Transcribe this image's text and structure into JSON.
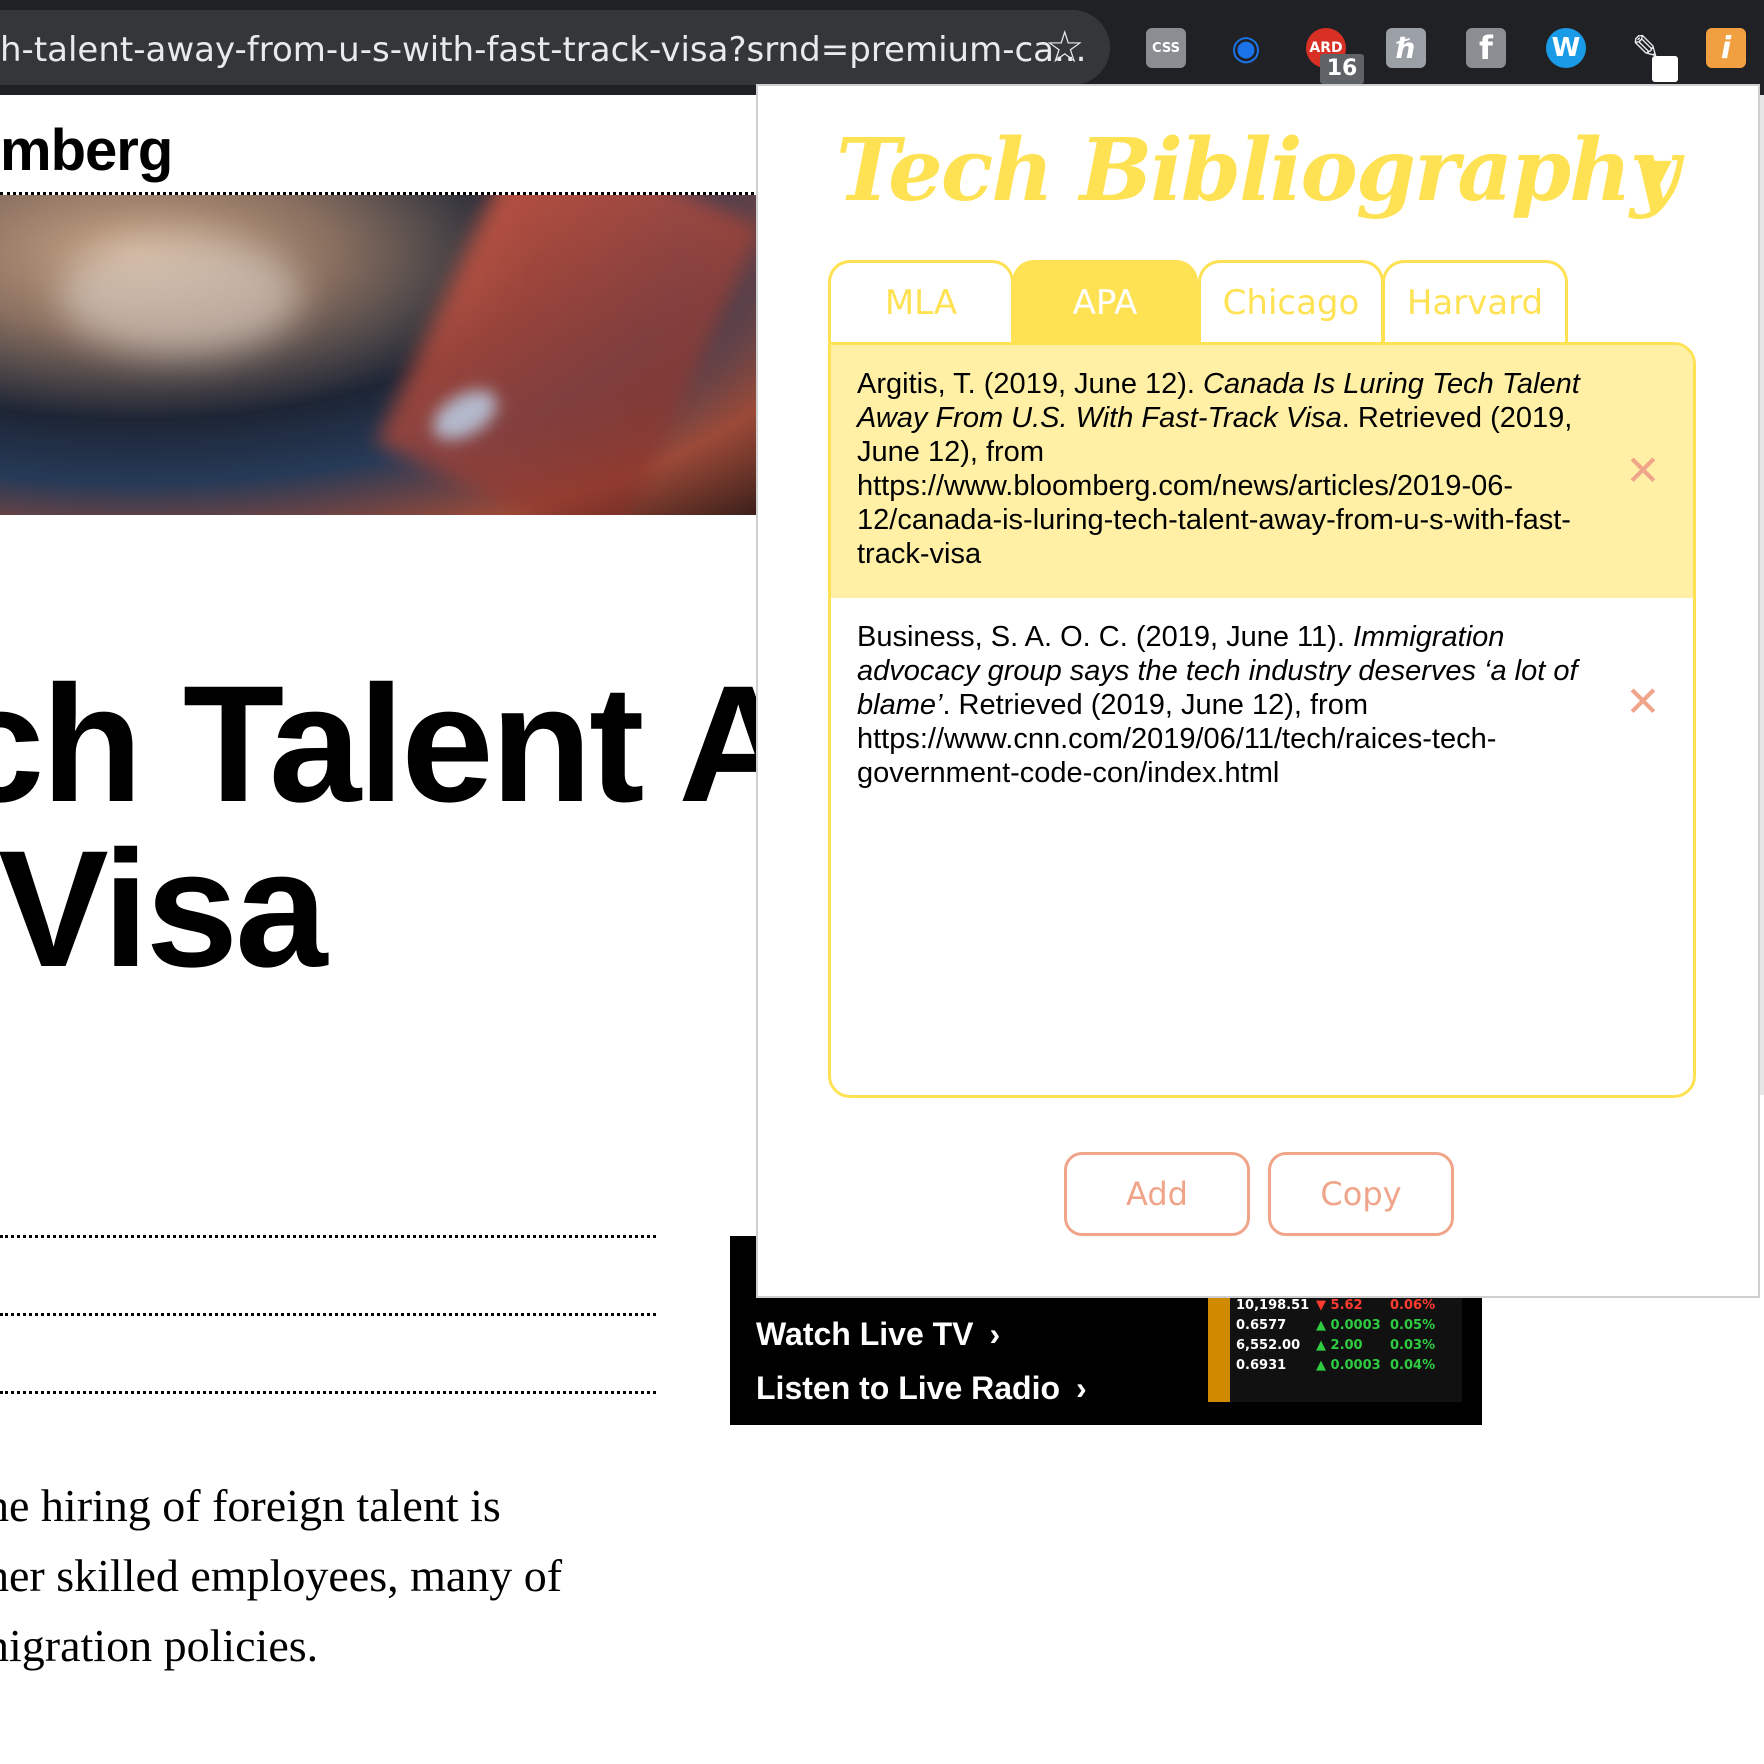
{
  "browser": {
    "url": "h-talent-away-from-u-s-with-fast-track-visa?srnd=premium-ca...",
    "extensions": [
      {
        "name": "css-viewer",
        "glyph": "CSS",
        "color": "#8a8d91"
      },
      {
        "name": "network-globe",
        "glyph": "◉",
        "color": "#1a73e8"
      },
      {
        "name": "ard",
        "glyph": "ARD",
        "color": "#d93025"
      },
      {
        "name": "lemon",
        "glyph": "ℏ",
        "color": "#9aa0a6"
      },
      {
        "name": "facebook",
        "glyph": "f",
        "color": "#8a8d91"
      },
      {
        "name": "wordpress",
        "glyph": "W",
        "color": "#1a9be8"
      },
      {
        "name": "pen",
        "glyph": "✎",
        "color": "#202124"
      },
      {
        "name": "info",
        "glyph": "i",
        "color": "#f0a040"
      }
    ],
    "ard_badge": "16"
  },
  "article": {
    "brand": "mberg",
    "headline_line1": "ch Talent Av",
    "headline_line2": "Visa",
    "body_lines": [
      "he hiring of foreign talent is",
      "her skilled employees, many of",
      "nigration policies."
    ],
    "promo": {
      "watch": "Watch Live TV",
      "listen": "Listen to Live Radio",
      "ticker": [
        {
          "value": "10,198.51",
          "dir": "down",
          "change": "5.62",
          "pct": "0.06%"
        },
        {
          "value": "0.6577",
          "dir": "up",
          "change": "0.0003",
          "pct": "0.05%"
        },
        {
          "value": "6,552.00",
          "dir": "up",
          "change": "2.00",
          "pct": "0.03%"
        },
        {
          "value": "0.6931",
          "dir": "up",
          "change": "0.0003",
          "pct": "0.04%"
        }
      ]
    }
  },
  "popup": {
    "title": "Tech Bibliography",
    "toggle": "▼",
    "tabs": [
      {
        "label": "MLA",
        "active": false
      },
      {
        "label": "APA",
        "active": true
      },
      {
        "label": "Chicago",
        "active": false
      },
      {
        "label": "Harvard",
        "active": false
      }
    ],
    "entries": [
      {
        "author_date": "Argitis, T. (2019, June 12). ",
        "title": "Canada Is Luring Tech Talent Away From U.S. With Fast-Track Visa",
        "rest": ". Retrieved (2019, June 12), from https://www.bloomberg.com/news/articles/2019-06-12/canada-is-luring-tech-talent-away-from-u-s-with-fast-track-visa",
        "remove": "✕"
      },
      {
        "author_date": "Business, S. A. O. C. (2019, June 11). ",
        "title": "Immigration advocacy group says the tech industry deserves ‘a lot of blame’",
        "rest": ". Retrieved (2019, June 12), from https://www.cnn.com/2019/06/11/tech/raices-tech-government-code-con/index.html",
        "remove": "✕"
      }
    ],
    "buttons": {
      "add": "Add",
      "copy": "Copy"
    }
  }
}
